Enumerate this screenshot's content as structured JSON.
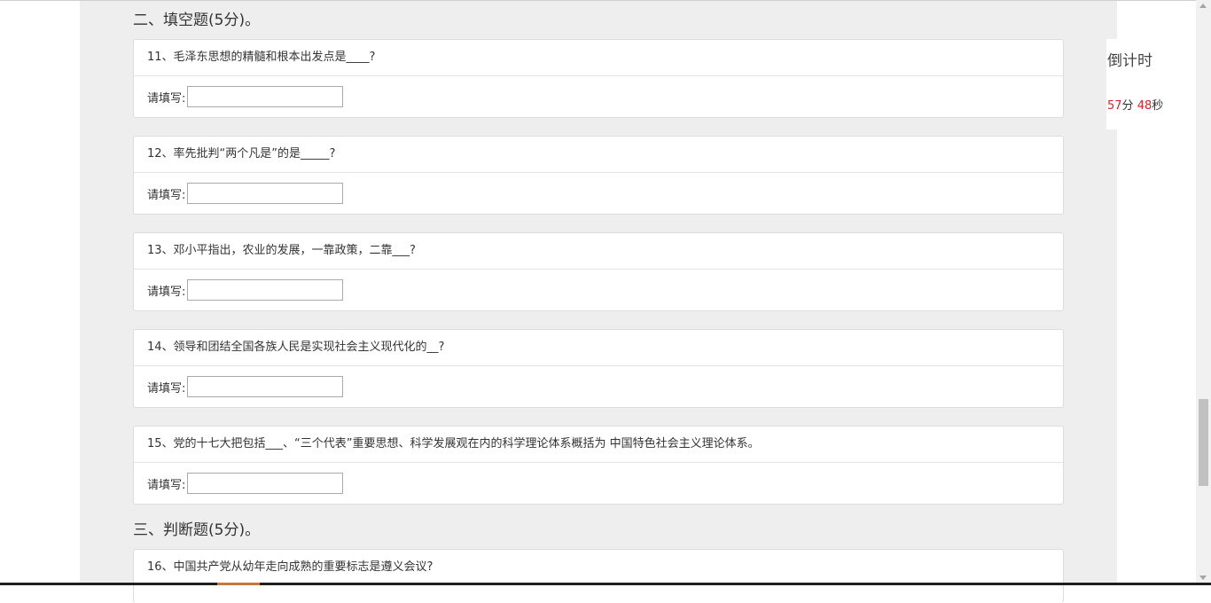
{
  "section_fill": {
    "heading": "二、填空题(5分)。"
  },
  "questions": [
    {
      "text": "11、毛泽东思想的精髓和根本出发点是____?",
      "label": "请填写:",
      "value": ""
    },
    {
      "text": "12、率先批判“两个凡是”的是_____?",
      "label": "请填写:",
      "value": ""
    },
    {
      "text": "13、邓小平指出，农业的发展，一靠政策，二靠___?",
      "label": "请填写:",
      "value": ""
    },
    {
      "text": "14、领导和团结全国各族人民是实现社会主义现代化的__?",
      "label": "请填写:",
      "value": ""
    },
    {
      "text": "15、党的十七大把包括___、“三个代表”重要思想、科学发展观在内的科学理论体系概括为 中国特色社会主义理论体系。",
      "label": "请填写:",
      "value": ""
    }
  ],
  "section_judge": {
    "heading": "三、判断题(5分)。",
    "question16": "16、中国共产党从幼年走向成熟的重要标志是遵义会议?"
  },
  "countdown": {
    "title": "倒计时",
    "minutes": "57",
    "minutes_unit": "分",
    "seconds": "48",
    "seconds_unit": "秒"
  },
  "colors": {
    "panel_bg": "#eeeeee",
    "countdown_number": "#e02020",
    "text": "#333333"
  },
  "icons": {
    "scroll_up": "triangle-up",
    "scroll_down": "triangle-down"
  }
}
